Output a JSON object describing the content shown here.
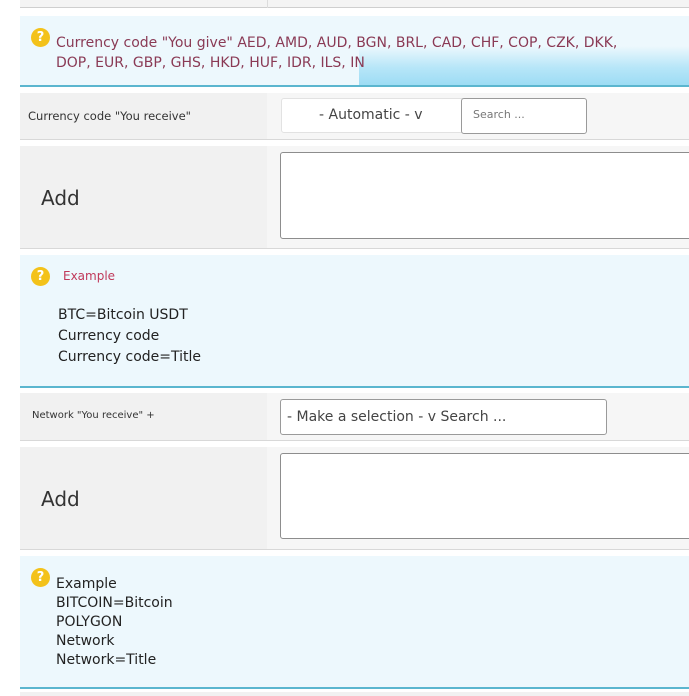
{
  "currency_give_help": {
    "text": "Currency code \"You give\" AED, AMD, AUD, BGN, BRL, CAD, CHF, COP, CZK, DKK, DOP, EUR, GBP, GHS, HKD, HUF, IDR, ILS, IN"
  },
  "currency_receive_row": {
    "label": "Currency code \"You receive\"",
    "select_value": "- Automatic - v",
    "search_placeholder": "Search ..."
  },
  "currency_add_row": {
    "label": "Add"
  },
  "currency_example_help": {
    "title": "Example",
    "lines": [
      "BTC=Bitcoin USDT",
      "Currency code",
      "Currency code=Title"
    ]
  },
  "network_receive_row": {
    "label": "Network \"You receive\" +",
    "select_value": "- Make a selection - v Search ..."
  },
  "network_add_row": {
    "label": "Add"
  },
  "network_example_help": {
    "lines": [
      "Example",
      "BITCOIN=Bitcoin",
      "POLYGON",
      "Network",
      "Network=Title"
    ]
  },
  "icons": {
    "help": "question-circle-icon"
  },
  "colors": {
    "help_bg": "#edf8fd",
    "help_border": "#5bb6cf",
    "icon": "#f3c21a",
    "codes_text": "#8a3a55",
    "example_title": "#c0395a"
  }
}
